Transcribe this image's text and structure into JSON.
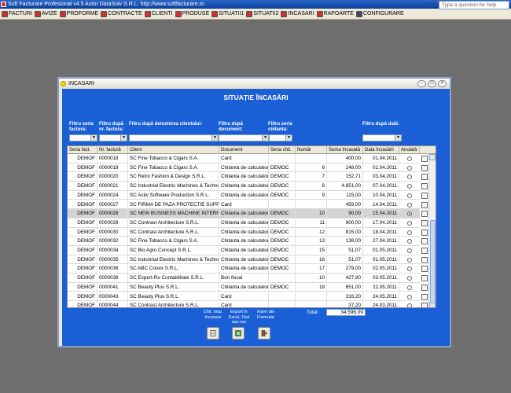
{
  "app": {
    "title": "Soft Facturare Profesional v4.5 Autor DataSolv S.R.L. http://www.softfacturare.ro"
  },
  "menu": {
    "items": [
      "FACTURI",
      "AVIZE",
      "PROFORME",
      "CONTRACTE",
      "CLIENTI",
      "PRODUSE",
      "SITUATII1",
      "SITUATII2",
      "INCASARI",
      "RAPOARTE",
      "CONFIGURARE"
    ],
    "help_placeholder": "Type a question for help",
    "mdi_controls": "- ▫ ×"
  },
  "window": {
    "title": "INCASARI",
    "min": "-",
    "max": "□",
    "close": "×"
  },
  "heading": "SITUAȚIE ÎNCASĂRI",
  "filters": {
    "serie_factura": "Filtru seria factura:",
    "nr_factura": "Filtru după nr. factura:",
    "client": "Filtru după denumirea clientului:",
    "document": "Filtru după document:",
    "serie_chitanta": "Filtru seria chitanta:",
    "data": "Filtru după dată:",
    "arrow": "▼"
  },
  "columns": [
    "Seria fact.",
    "Nr. factură",
    "Client",
    "Document",
    "Seria chit.",
    "Număr",
    "Suma încasată",
    "Data încasării",
    "Anulată"
  ],
  "rows": [
    [
      "DEMOF",
      "0000018",
      "SC Fine Tobacco & Cigars S.A.",
      "Card",
      "",
      "",
      "400,00",
      "01.04.2011"
    ],
    [
      "DEMOF",
      "0000019",
      "SC Fine Tobacco & Cigars S.A.",
      "Chitanta de calculator",
      "DEMOC",
      "6",
      "248,00",
      "01.04.2011"
    ],
    [
      "DEMOF",
      "0000020",
      "SC Retro Fashion & Design S.R.L.",
      "Chitanta de calculator",
      "DEMOC",
      "7",
      "152,71",
      "03.04.2011"
    ],
    [
      "DEMOF",
      "0000021",
      "SC Industrial Electric Machines & Techno",
      "Chitanta de calculator",
      "DEMOC",
      "8",
      "4.851,00",
      "07.04.2011"
    ],
    [
      "DEMOF",
      "0000024",
      "SC Activ Software Production S.R.L.",
      "Chitanta de calculator",
      "DEMOC",
      "9",
      "115,00",
      "10.04.2011"
    ],
    [
      "DEMOF",
      "0000027",
      "SC FIRMA DE PAZA PROTECTIE SUPRAV",
      "Card",
      "",
      "",
      "459,00",
      "14.04.2011"
    ],
    [
      "DEMOF",
      "0000028",
      "SC NEW BUSINESS MACHINE INTERNAT",
      "Chitanta de calculator",
      "DEMOC",
      "10",
      "90,00",
      "15.04.2011"
    ],
    [
      "DEMOF",
      "0000029",
      "SC Contrast Architecture S.R.L.",
      "Chitanta de calculator",
      "DEMOC",
      "11",
      "900,00",
      "17.04.2011"
    ],
    [
      "DEMOF",
      "0000030",
      "SC Contrast Architecture S.R.L.",
      "Chitanta de calculator",
      "DEMOC",
      "12",
      "815,00",
      "18.04.2011"
    ],
    [
      "DEMOF",
      "0000032",
      "SC Fine Tobacco & Cigars S.A.",
      "Chitanta de calculator",
      "DEMOC",
      "13",
      "138,00",
      "27.04.2011"
    ],
    [
      "DEMOF",
      "0000034",
      "SC Bio Agro Concept S.R.L.",
      "Chitanta de calculator",
      "DEMOC",
      "15",
      "51,07",
      "01.05.2011"
    ],
    [
      "DEMOF",
      "0000035",
      "SC Industrial Electric Machines & Techno",
      "Chitanta de calculator",
      "DEMOC",
      "16",
      "51,07",
      "01.05.2011"
    ],
    [
      "DEMOF",
      "0000036",
      "SC ABC Conex S.R.L.",
      "Chitanta de calculator",
      "DEMOC",
      "17",
      "279,00",
      "02.05.2011"
    ],
    [
      "DEMOF",
      "0000038",
      "SC Expert-Ro Contabilitate S.R.L.",
      "Bon fiscal",
      "",
      "10",
      "427,80",
      "03.05.2011"
    ],
    [
      "DEMOF",
      "0000041",
      "SC Beauty Plus S.R.L.",
      "Chitanta de calculator",
      "DEMOC",
      "18",
      "651,00",
      "22.05.2011"
    ],
    [
      "DEMOF",
      "0000043",
      "SC Beauty Plus S.R.L.",
      "Card",
      "",
      "",
      "316,20",
      "24.05.2011"
    ],
    [
      "DEMOF",
      "0000044",
      "SC Contrast Architecture S.R.L.",
      "Card",
      "",
      "",
      "37,20",
      "24.03.2011"
    ]
  ],
  "selected_row": 6,
  "total": {
    "label": "Total:",
    "value": "34.596,09"
  },
  "actions": [
    {
      "label": "Chit. disp. încasare"
    },
    {
      "label": "Export în Excel, Text sau csv"
    },
    {
      "label": "Ieșire din Formular"
    }
  ]
}
